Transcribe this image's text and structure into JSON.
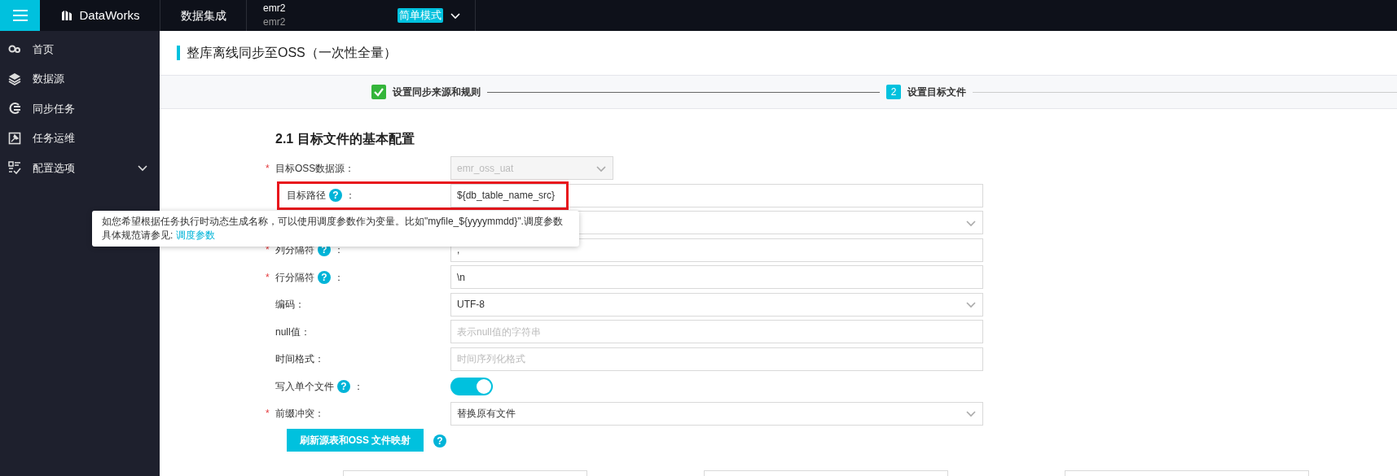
{
  "top_bar": {
    "product": "DataWorks",
    "module": "数据集成",
    "workspace": {
      "name": "emr2",
      "subtitle": "emr2"
    },
    "mode_badge": "简单模式"
  },
  "sidebar": {
    "items": [
      {
        "label": "首页"
      },
      {
        "label": "数据源"
      },
      {
        "label": "同步任务"
      },
      {
        "label": "任务运维"
      },
      {
        "label": "配置选项",
        "expanded": false
      }
    ]
  },
  "page_title": "整库离线同步至OSS（一次性全量）",
  "steps": [
    {
      "label": "设置同步来源和规则",
      "done": true
    },
    {
      "label": "设置目标文件",
      "done": false,
      "number": "2"
    }
  ],
  "section_heading": "2.1 目标文件的基本配置",
  "form": {
    "rows": [
      {
        "kind": "select",
        "required_mark": "*",
        "label": "目标OSS数据源：",
        "placeholder": "emr_oss_uat",
        "disabled": true,
        "highlighted": false
      },
      {
        "kind": "input",
        "label": "目标路径",
        "help_icon": "?",
        "colon": "：",
        "value": "${db_table_name_src}",
        "disabled": false,
        "highlighted": true
      },
      {
        "kind": "select",
        "disabled": false,
        "highlighted": false
      },
      {
        "kind": "input",
        "required_mark": "*",
        "label": "列分隔符",
        "help_icon": "?",
        "colon": "：",
        "value": ",",
        "disabled": false,
        "highlighted": false
      },
      {
        "kind": "input",
        "required_mark": "*",
        "label": "行分隔符",
        "help_icon": "?",
        "colon": "：",
        "value": "\\n",
        "disabled": false,
        "highlighted": false
      },
      {
        "kind": "select",
        "label": "编码：",
        "value": "UTF-8",
        "disabled": false,
        "highlighted": false
      },
      {
        "kind": "input",
        "label": "null值：",
        "placeholder": "表示null值的字符串",
        "disabled": false,
        "highlighted": false
      },
      {
        "kind": "input",
        "label": "时间格式：",
        "placeholder": "时间序列化格式",
        "disabled": false,
        "highlighted": false
      },
      {
        "kind": "toggle",
        "label": "写入单个文件",
        "help_icon": "?",
        "colon": "：",
        "on": true,
        "highlighted": false
      },
      {
        "kind": "select",
        "required_mark": "*",
        "label": "前缀冲突：",
        "value": "替换原有文件",
        "disabled": false,
        "highlighted": false
      }
    ],
    "refresh_button": "刷新源表和OSS 文件映射",
    "refresh_help_icon": "?"
  },
  "tooltip": {
    "text": "如您希望根据任务执行时动态生成名称，可以使用调度参数作为变量。比如\"myfile_${yyyymmdd}\".调度参数具体规范请参见: ",
    "link": "调度参数"
  },
  "bottom_fields": [
    {
      "kind": "input"
    },
    {
      "kind": "input"
    },
    {
      "kind": "input"
    }
  ]
}
